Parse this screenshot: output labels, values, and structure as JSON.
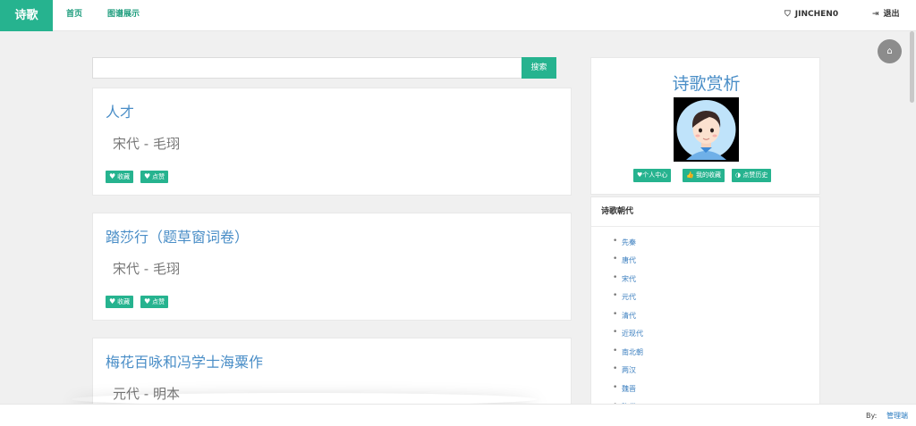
{
  "navbar": {
    "brand": "诗歌",
    "links": [
      "首页",
      "图谱展示"
    ],
    "user_icon": "shield-icon",
    "username": "JINCHEN0",
    "logout_icon": "sign-out-icon",
    "logout": "退出"
  },
  "home_button_icon": "home-icon",
  "search": {
    "value": "",
    "placeholder": "",
    "button": "搜索"
  },
  "poems": [
    {
      "title": "人才",
      "meta": "宋代 - 毛珝",
      "favorite": "收藏",
      "like": "点赞"
    },
    {
      "title": "踏莎行（题草窗词卷）",
      "meta": "宋代 - 毛珝",
      "favorite": "收藏",
      "like": "点赞"
    },
    {
      "title": "梅花百咏和冯学士海粟作",
      "meta": "元代 - 明本"
    }
  ],
  "sidebar": {
    "title": "诗歌赏析",
    "avatar_icon": "avatar-icon",
    "buttons": [
      "个人中心",
      "我的收藏",
      "点赞历史"
    ]
  },
  "dynasties": {
    "heading": "诗歌朝代",
    "items": [
      "先秦",
      "唐代",
      "宋代",
      "元代",
      "清代",
      "近现代",
      "南北朝",
      "两汉",
      "魏晋",
      "隋代"
    ]
  },
  "footer": {
    "by": "By:",
    "admin": "管理端"
  },
  "colors": {
    "accent": "#26b38f",
    "link": "#4a8ec7",
    "background": "#f0f0f0"
  }
}
